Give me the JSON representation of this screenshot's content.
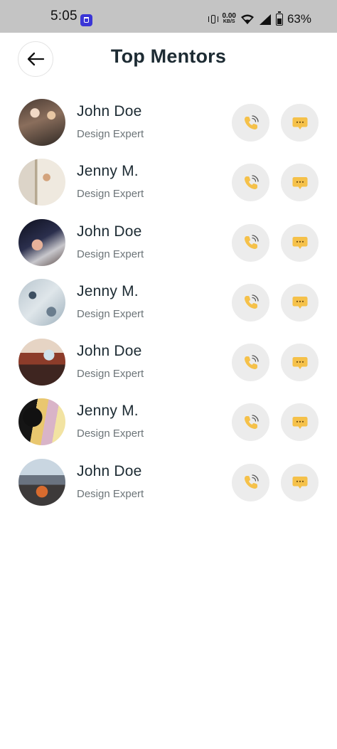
{
  "status_bar": {
    "time": "5:05",
    "net_speed_value": "0.00",
    "net_speed_unit": "KB/S",
    "battery": "63%"
  },
  "header": {
    "title": "Top Mentors",
    "back_icon": "arrow-left-icon"
  },
  "colors": {
    "accent": "#f5c14a",
    "action_bg": "#ececec",
    "title": "#1d2b33",
    "subtitle": "#6c7478"
  },
  "mentors": [
    {
      "name": "John Doe",
      "role": "Design Expert"
    },
    {
      "name": "Jenny M.",
      "role": "Design Expert"
    },
    {
      "name": "John Doe",
      "role": "Design Expert"
    },
    {
      "name": "Jenny M.",
      "role": "Design Expert"
    },
    {
      "name": "John Doe",
      "role": "Design Expert"
    },
    {
      "name": "Jenny M.",
      "role": "Design Expert"
    },
    {
      "name": "John Doe",
      "role": "Design Expert"
    }
  ]
}
